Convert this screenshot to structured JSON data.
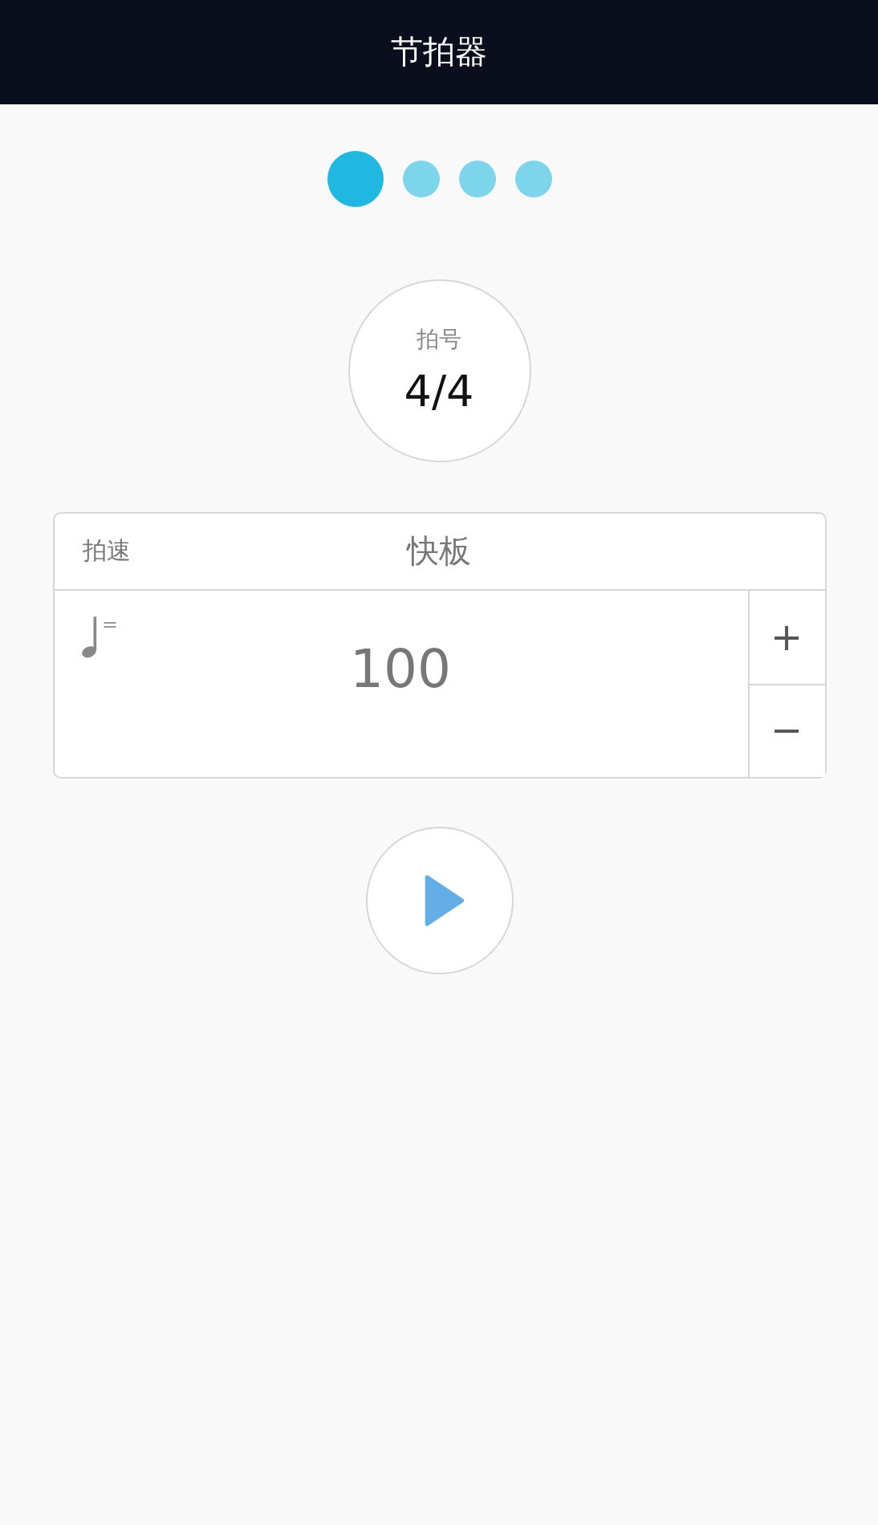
{
  "header": {
    "title": "节拍器"
  },
  "beats": [
    {
      "selected": true
    },
    {
      "selected": false
    },
    {
      "selected": false
    },
    {
      "selected": false
    }
  ],
  "time_signature": {
    "label": "拍号",
    "value": "4/4"
  },
  "tempo": {
    "label": "拍速",
    "name": "快板",
    "note_equals": "=",
    "value": "100",
    "increase": "+",
    "decrease": "−"
  },
  "play_button": {
    "kind": "play"
  }
}
